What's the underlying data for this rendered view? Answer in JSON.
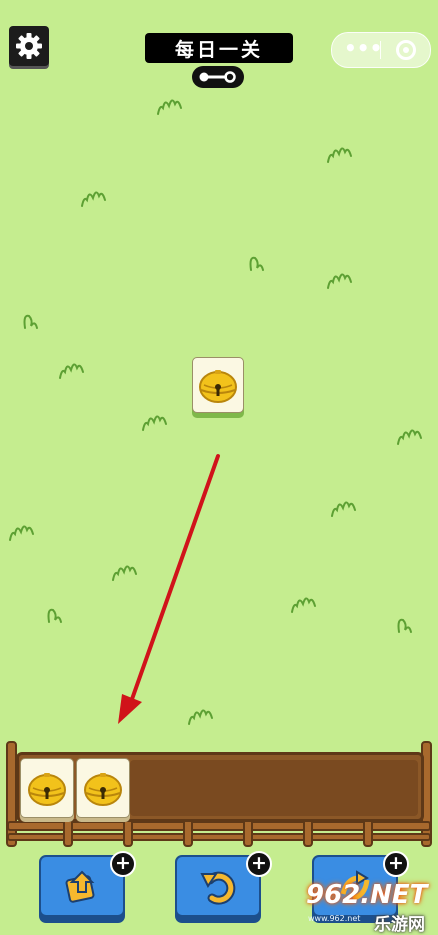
{
  "header": {
    "title": "每日一关",
    "settings_icon": "gear-icon",
    "key_icon": "key-icon"
  },
  "capsule": {
    "more_icon": "more-dots-icon",
    "close_icon": "close-circle-icon"
  },
  "board": {
    "tiles": [
      {
        "icon": "bell-icon"
      }
    ]
  },
  "slot_tray": {
    "capacity": 7,
    "filled": [
      {
        "icon": "bell-icon"
      },
      {
        "icon": "bell-icon"
      }
    ]
  },
  "toolbar": {
    "buttons": [
      {
        "name": "remove-tiles-button",
        "icon": "move-out-icon",
        "badge": "+"
      },
      {
        "name": "undo-button",
        "icon": "undo-icon",
        "badge": "+"
      },
      {
        "name": "shuffle-button",
        "icon": "shuffle-icon",
        "badge": "+"
      }
    ]
  },
  "watermark": {
    "logo": "962.NET",
    "subtitle": "乐游网",
    "url": "www.962.net"
  },
  "colors": {
    "grass": "#c5ed8f",
    "tray_wood": "#8c5827",
    "button_blue": "#3a8de3",
    "arrow_red": "#d0131a"
  }
}
